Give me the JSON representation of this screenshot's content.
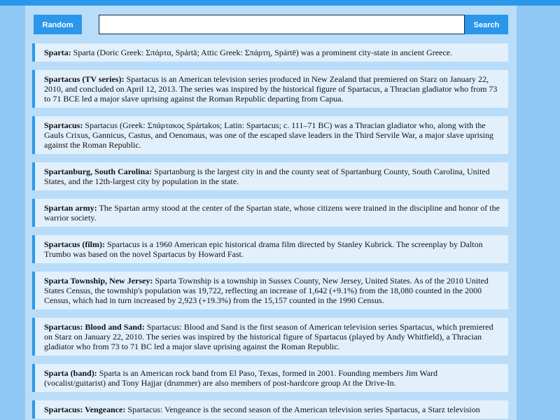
{
  "toolbar": {
    "random_label": "Random",
    "search_label": "Search",
    "search_value": "",
    "search_placeholder": ""
  },
  "results": [
    {
      "title": "Sparta:",
      "text": "Sparta (Doric Greek: Σπάρτα, Spártā; Attic Greek: Σπάρτη, Spártē) was a prominent city-state in ancient Greece."
    },
    {
      "title": "Spartacus (TV series):",
      "text": "Spartacus is an American television series produced in New Zealand that premiered on Starz on January 22, 2010, and concluded on April 12, 2013. The series was inspired by the historical figure of Spartacus, a Thracian gladiator who from 73 to 71 BCE led a major slave uprising against the Roman Republic departing from Capua."
    },
    {
      "title": "Spartacus:",
      "text": "Spartacus (Greek: Σπάρτακος Spártakos; Latin: Spartacus; c. 111–71 BC) was a Thracian gladiator who, along with the Gauls Crixus, Gannicus, Castus, and Oenomaus, was one of the escaped slave leaders in the Third Servile War, a major slave uprising against the Roman Republic."
    },
    {
      "title": "Spartanburg, South Carolina:",
      "text": "Spartanburg is the largest city in and the county seat of Spartanburg County, South Carolina, United States, and the 12th-largest city by population in the state."
    },
    {
      "title": "Spartan army:",
      "text": "The Spartan army stood at the center of the Spartan state, whose citizens were trained in the discipline and honor of the warrior society."
    },
    {
      "title": "Spartacus (film):",
      "text": "Spartacus is a 1960 American epic historical drama film directed by Stanley Kubrick. The screenplay by Dalton Trumbo was based on the novel Spartacus by Howard Fast."
    },
    {
      "title": "Sparta Township, New Jersey:",
      "text": "Sparta Township is a township in Sussex County, New Jersey, United States. As of the 2010 United States Census, the township's population was 19,722, reflecting an increase of 1,642 (+9.1%) from the 18,080 counted in the 2000 Census, which had in turn increased by 2,923 (+19.3%) from the 15,157 counted in the 1990 Census."
    },
    {
      "title": "Spartacus: Blood and Sand:",
      "text": "Spartacus: Blood and Sand is the first season of American television series Spartacus, which premiered on Starz on January 22, 2010. The series was inspired by the historical figure of Spartacus (played by Andy Whitfield), a Thracian gladiator who from 73 to 71 BC led a major slave uprising against the Roman Republic."
    },
    {
      "title": "Sparta (band):",
      "text": "Sparta is an American rock band from El Paso, Texas, formed in 2001. Founding members Jim Ward (vocalist/guitarist) and Tony Hajjar (drummer) are also members of post-hardcore group At the Drive-In."
    },
    {
      "title": "Spartacus: Vengeance:",
      "text": "Spartacus: Vengeance is the second season of the American television series Spartacus, a Starz television"
    }
  ]
}
